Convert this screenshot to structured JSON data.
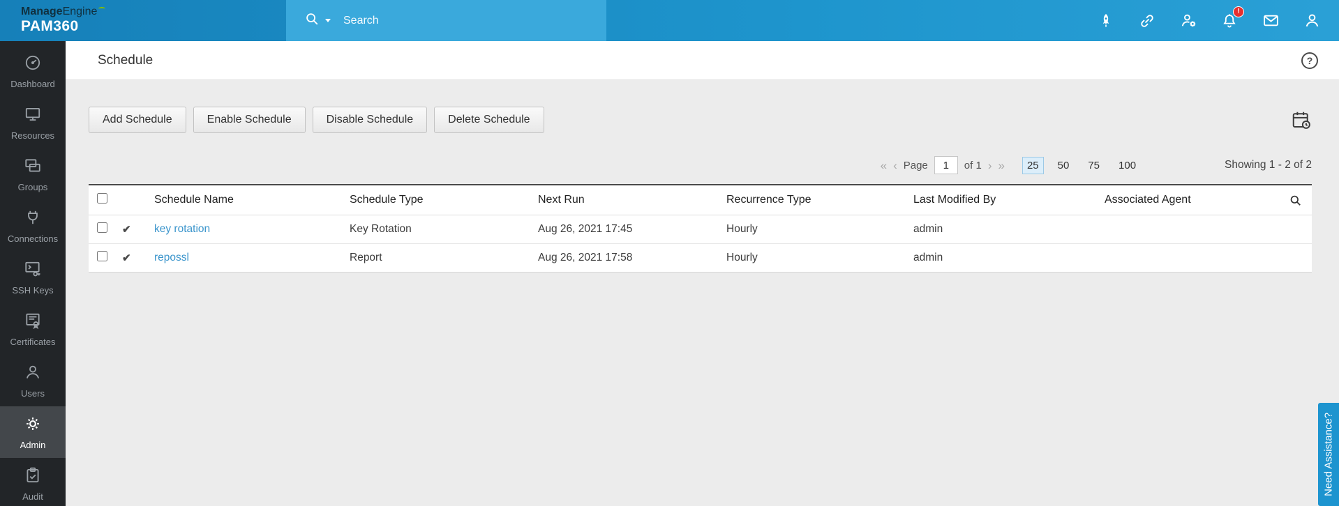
{
  "topbar": {
    "brand_bold": "Manage",
    "brand_rest": "Engine",
    "product": "PAM360",
    "search_placeholder": "Search",
    "bell_badge": "!"
  },
  "sidebar": {
    "items": [
      {
        "label": "Dashboard"
      },
      {
        "label": "Resources"
      },
      {
        "label": "Groups"
      },
      {
        "label": "Connections"
      },
      {
        "label": "SSH Keys"
      },
      {
        "label": "Certificates"
      },
      {
        "label": "Users"
      },
      {
        "label": "Admin",
        "active": true
      },
      {
        "label": "Audit"
      }
    ]
  },
  "page": {
    "title": "Schedule",
    "help_glyph": "?"
  },
  "toolbar": {
    "buttons": [
      {
        "label": "Add Schedule"
      },
      {
        "label": "Enable Schedule"
      },
      {
        "label": "Disable Schedule"
      },
      {
        "label": "Delete Schedule"
      }
    ]
  },
  "pagination": {
    "icons": {
      "first": "«",
      "prev": "‹",
      "next": "›",
      "last": "»"
    },
    "page_label": "Page",
    "page_value": "1",
    "of_label": "of 1",
    "sizes": [
      "25",
      "50",
      "75",
      "100"
    ],
    "active_size": "25",
    "showing": "Showing 1 - 2 of 2"
  },
  "table": {
    "check_glyph": "✔",
    "columns": [
      "Schedule Name",
      "Schedule Type",
      "Next Run",
      "Recurrence Type",
      "Last Modified By",
      "Associated Agent"
    ],
    "rows": [
      {
        "name": "key rotation",
        "type": "Key Rotation",
        "next_run": "Aug 26, 2021 17:45",
        "recurrence": "Hourly",
        "modified_by": "admin",
        "agent": ""
      },
      {
        "name": "repossl",
        "type": "Report",
        "next_run": "Aug 26, 2021 17:58",
        "recurrence": "Hourly",
        "modified_by": "admin",
        "agent": ""
      }
    ]
  },
  "assist": {
    "label": "Need Assistance?"
  },
  "colors": {
    "topbar": "#1e95cd",
    "accent": "#1d94cf",
    "link": "#3b95cc",
    "sidebar": "#222528",
    "badge": "#e62e2e"
  }
}
